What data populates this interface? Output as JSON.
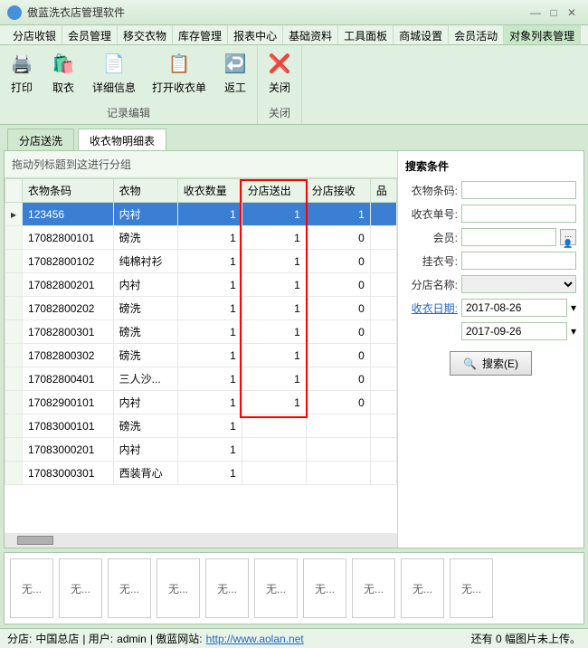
{
  "title": "傲蓝洗衣店管理软件",
  "menus": [
    "分店收银",
    "会员管理",
    "移交衣物",
    "库存管理",
    "报表中心",
    "基础资料",
    "工具面板",
    "商城设置",
    "会员活动",
    "对象列表管理"
  ],
  "active_menu": 9,
  "ribbon": {
    "group1": {
      "label": "记录编辑",
      "btns": [
        {
          "icon": "🖨️",
          "label": "打印"
        },
        {
          "icon": "🛍️",
          "label": "取衣"
        },
        {
          "icon": "📄",
          "label": "详细信息"
        },
        {
          "icon": "📋",
          "label": "打开收衣单"
        },
        {
          "icon": "↩️",
          "label": "返工"
        }
      ]
    },
    "group2": {
      "label": "关闭",
      "btns": [
        {
          "icon": "❌",
          "label": "关闭"
        }
      ]
    }
  },
  "tabs": [
    {
      "label": "分店送洗",
      "active": false
    },
    {
      "label": "收衣物明细表",
      "active": true
    }
  ],
  "group_hint": "拖动列标题到这进行分组",
  "columns": [
    "衣物条码",
    "衣物",
    "收衣数量",
    "分店送出",
    "分店接收",
    "品"
  ],
  "rows": [
    {
      "c": [
        "123456",
        "内衬",
        "1",
        "1",
        "1",
        ""
      ],
      "sel": true
    },
    {
      "c": [
        "17082800101",
        "磅洗",
        "1",
        "1",
        "0",
        ""
      ]
    },
    {
      "c": [
        "17082800102",
        "纯棉衬衫",
        "1",
        "1",
        "0",
        ""
      ]
    },
    {
      "c": [
        "17082800201",
        "内衬",
        "1",
        "1",
        "0",
        ""
      ]
    },
    {
      "c": [
        "17082800202",
        "磅洗",
        "1",
        "1",
        "0",
        ""
      ]
    },
    {
      "c": [
        "17082800301",
        "磅洗",
        "1",
        "1",
        "0",
        ""
      ]
    },
    {
      "c": [
        "17082800302",
        "磅洗",
        "1",
        "1",
        "0",
        ""
      ]
    },
    {
      "c": [
        "17082800401",
        "三人沙...",
        "1",
        "1",
        "0",
        ""
      ]
    },
    {
      "c": [
        "17082900101",
        "内衬",
        "1",
        "1",
        "0",
        ""
      ]
    },
    {
      "c": [
        "17083000101",
        "磅洗",
        "1",
        "",
        "",
        ""
      ]
    },
    {
      "c": [
        "17083000201",
        "内衬",
        "1",
        "",
        "",
        ""
      ]
    },
    {
      "c": [
        "17083000301",
        "西装背心",
        "1",
        "",
        "",
        ""
      ]
    }
  ],
  "search": {
    "title": "搜索条件",
    "fields": {
      "barcode": "衣物条码:",
      "receipt": "收衣单号:",
      "member": "会员:",
      "hanger": "挂衣号:",
      "branch": "分店名称:",
      "date": "收衣日期:"
    },
    "date_from": "2017-08-26",
    "date_to": "2017-09-26",
    "btn": "搜索(E)"
  },
  "thumbs": [
    "无...",
    "无...",
    "无...",
    "无...",
    "无...",
    "无...",
    "无...",
    "无...",
    "无...",
    "无..."
  ],
  "status": {
    "branch_lbl": "分店: ",
    "branch": "中国总店",
    "user_lbl": " | 用户: ",
    "user": "admin",
    "site_lbl": " | 傲蓝网站: ",
    "url": "http://www.aolan.net",
    "right": "还有 0 幅图片未上传。"
  }
}
